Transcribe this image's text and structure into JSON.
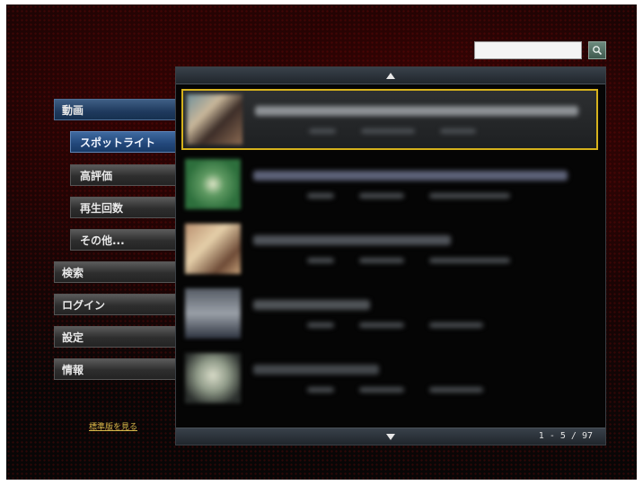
{
  "search": {
    "placeholder": ""
  },
  "sidebar": {
    "items": [
      {
        "label": "動画"
      },
      {
        "label": "スポットライト"
      },
      {
        "label": "高評価"
      },
      {
        "label": "再生回数"
      },
      {
        "label": "その他..."
      },
      {
        "label": "検索"
      },
      {
        "label": "ログイン"
      },
      {
        "label": "設定"
      },
      {
        "label": "情報"
      }
    ],
    "standard_link": "標準版を見る"
  },
  "panel": {
    "pager": "1 - 5 / 97"
  },
  "colors": {
    "selection_border": "#d6b21c",
    "active_nav": "#1f3a5e",
    "active_subnav": "#22477a",
    "link": "#d7b84a"
  },
  "icons": [
    "search-icon",
    "arrow-up-icon",
    "arrow-down-icon"
  ]
}
